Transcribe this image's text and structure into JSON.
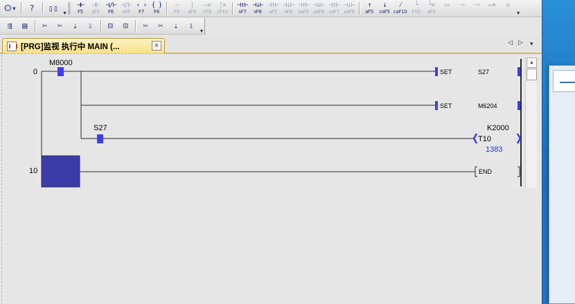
{
  "toolbar1": {
    "items": [
      {
        "kind": "sq",
        "glyph": "ⵙ▾",
        "name": "find-dropdown-button"
      },
      {
        "kind": "sep"
      },
      {
        "kind": "sq",
        "glyph": "?",
        "name": "help-button"
      },
      {
        "kind": "sep"
      },
      {
        "kind": "sq",
        "glyph": "▯▯",
        "name": "binoculars-button"
      },
      {
        "kind": "overflow"
      },
      {
        "kind": "grip"
      },
      {
        "kind": "fn",
        "glyph": "⊣⊢",
        "fkey": "F5",
        "name": "contact-open-button"
      },
      {
        "kind": "fn",
        "glyph": "⊣⊢",
        "fkey": "sF5",
        "name": "parallel-contact-open-button",
        "dim": true
      },
      {
        "kind": "fn",
        "glyph": "⊣/⊢",
        "fkey": "F6",
        "name": "contact-closed-button"
      },
      {
        "kind": "fn",
        "glyph": "⊣/⊢",
        "fkey": "sF6",
        "name": "parallel-contact-closed-button",
        "dim": true
      },
      {
        "kind": "fn",
        "glyph": "‹ ›",
        "fkey": "F7",
        "name": "coil-button"
      },
      {
        "kind": "fn",
        "glyph": "{ }",
        "fkey": "F8",
        "name": "application-instruction-button"
      },
      {
        "kind": "sep"
      },
      {
        "kind": "fn",
        "glyph": "—",
        "fkey": "F9",
        "name": "horizontal-line-button",
        "dim": true
      },
      {
        "kind": "fn",
        "glyph": "¦",
        "fkey": "sF9",
        "name": "vertical-line-button",
        "dim": true
      },
      {
        "kind": "fn",
        "glyph": "—×",
        "fkey": "cF9",
        "name": "delete-horizontal-button",
        "dim": true
      },
      {
        "kind": "fn",
        "glyph": "¦×",
        "fkey": "cF10",
        "name": "delete-vertical-button",
        "dim": true
      },
      {
        "kind": "sep"
      },
      {
        "kind": "fn",
        "glyph": "⊣↑⊢",
        "fkey": "sF7",
        "name": "rising-edge-button"
      },
      {
        "kind": "fn",
        "glyph": "⊣↓⊢",
        "fkey": "sF8",
        "name": "falling-edge-button"
      },
      {
        "kind": "fn",
        "glyph": "⊣↑⊢",
        "fkey": "aF7",
        "name": "parallel-rising-edge-button",
        "dim": true
      },
      {
        "kind": "fn",
        "glyph": "⊣↓⊢",
        "fkey": "aF8",
        "name": "parallel-falling-edge-button",
        "dim": true
      },
      {
        "kind": "fn",
        "glyph": "⊣↑⊢",
        "fkey": "saF5",
        "name": "rising-edge-negated-button",
        "dim": true
      },
      {
        "kind": "fn",
        "glyph": "⊣↓⊢",
        "fkey": "saF6",
        "name": "falling-edge-negated-button",
        "dim": true
      },
      {
        "kind": "fn",
        "glyph": "⊣↑⊢",
        "fkey": "saF7",
        "name": "parallel-rising-negated-button",
        "dim": true
      },
      {
        "kind": "fn",
        "glyph": "⊣↓⊢",
        "fkey": "saF8",
        "name": "parallel-falling-negated-button",
        "dim": true
      },
      {
        "kind": "sep"
      },
      {
        "kind": "fn",
        "glyph": "↑",
        "fkey": "aF5",
        "name": "operation-rising-button"
      },
      {
        "kind": "fn",
        "glyph": "↓",
        "fkey": "caF5",
        "name": "operation-falling-button"
      },
      {
        "kind": "fn",
        "glyph": "⁄",
        "fkey": "caF10",
        "name": "operation-invert-button"
      },
      {
        "kind": "fn",
        "glyph": "└",
        "fkey": "F10",
        "name": "line-draw-button",
        "dim": true
      },
      {
        "kind": "fn",
        "glyph": "└×",
        "fkey": "aF9",
        "name": "line-delete-button",
        "dim": true
      },
      {
        "kind": "fn",
        "glyph": "▭",
        "fkey": "",
        "name": "toolbar-misc-button-1",
        "dim": true
      },
      {
        "kind": "fn",
        "glyph": "⤳",
        "fkey": "",
        "name": "toolbar-misc-button-2",
        "dim": true
      },
      {
        "kind": "fn",
        "glyph": "⤳",
        "fkey": "",
        "name": "toolbar-misc-button-3",
        "dim": true
      },
      {
        "kind": "fn",
        "glyph": "▭▾",
        "fkey": "",
        "name": "toolbar-misc-button-4",
        "dim": true
      },
      {
        "kind": "fn",
        "glyph": "◇",
        "fkey": "",
        "name": "toolbar-misc-button-5",
        "dim": true
      },
      {
        "kind": "overflow"
      }
    ]
  },
  "toolbar2": {
    "items": [
      {
        "kind": "sq",
        "glyph": "⇶",
        "name": "comment-mode-button"
      },
      {
        "kind": "sq",
        "glyph": "▤",
        "name": "statement-mode-button"
      },
      {
        "kind": "sep"
      },
      {
        "kind": "sq",
        "glyph": "✂",
        "name": "tool-a-button"
      },
      {
        "kind": "sq",
        "glyph": "✂",
        "name": "tool-b-button"
      },
      {
        "kind": "sq",
        "glyph": "⇣",
        "name": "tool-c-button"
      },
      {
        "kind": "sq",
        "glyph": "⇩",
        "name": "tool-d-button"
      },
      {
        "kind": "sep"
      },
      {
        "kind": "sq",
        "glyph": "⊟",
        "name": "tool-e-button"
      },
      {
        "kind": "sq",
        "glyph": "⊡",
        "name": "tool-f-button"
      },
      {
        "kind": "sep"
      },
      {
        "kind": "sq",
        "glyph": "✂",
        "name": "tool-g-button"
      },
      {
        "kind": "sq",
        "glyph": "✂",
        "name": "tool-h-button"
      },
      {
        "kind": "sq",
        "glyph": "⇣",
        "name": "tool-i-button"
      },
      {
        "kind": "sq",
        "glyph": "⇩",
        "name": "tool-j-button"
      },
      {
        "kind": "overflow"
      }
    ]
  },
  "tab": {
    "title": "[PRG]监视 执行中 MAIN (...",
    "close": "×"
  },
  "nav": {
    "prev": "◁",
    "next": "▷",
    "menu": "▾"
  },
  "scrollbar": {
    "up": "▲",
    "down": "▼"
  },
  "ladder": {
    "colors": {
      "wire": "#2b2b2b",
      "active": "#3d3df0",
      "cursor": "#3c3ca8",
      "value": "#2f2fd0"
    },
    "rungs": [
      {
        "step": "0",
        "elements": [
          {
            "type": "contact",
            "device": "M8000",
            "active": true
          },
          {
            "type": "coil-set",
            "label": "SET",
            "device": "S27",
            "active": true
          },
          {
            "type": "coil-set",
            "label": "SET",
            "device": "M6204",
            "active": true
          },
          {
            "type": "contact",
            "device": "S27",
            "active": true
          },
          {
            "type": "timer",
            "device": "T10",
            "setting": "K2000",
            "current": "1383",
            "active": true
          }
        ]
      },
      {
        "step": "10",
        "elements": [
          {
            "type": "end",
            "label": "END"
          }
        ]
      }
    ]
  }
}
